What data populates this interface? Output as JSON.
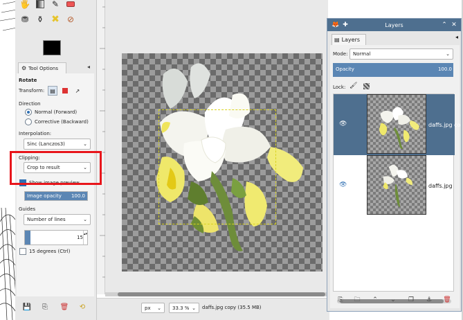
{
  "tool_options": {
    "tab_label": "Tool Options",
    "title": "Rotate",
    "transform_label": "Transform:",
    "direction_label": "Direction",
    "direction_options": [
      "Normal (Forward)",
      "Corrective (Backward)"
    ],
    "interpolation_label": "Interpolation:",
    "interpolation_value": "Sinc (Lanczos3)",
    "clipping_label": "Clipping:",
    "clipping_value": "Crop to result",
    "show_preview_label": "Show image preview",
    "image_opacity_label": "Image opacity",
    "image_opacity_value": "100.0",
    "guides_label": "Guides",
    "guides_value": "Number of lines",
    "guides_count": "15",
    "constraint_label": "15 degrees  (Ctrl)"
  },
  "status_bar": {
    "unit": "px",
    "zoom": "33.3 %",
    "image_info": "daffs.jpg copy (35.5 MB)"
  },
  "layers": {
    "window_title": "Layers",
    "tab_label": "Layers",
    "mode_label": "Mode:",
    "mode_value": "Normal",
    "opacity_label": "Opacity",
    "opacity_value": "100.0",
    "lock_label": "Lock:",
    "items": [
      {
        "name": "daffs.jpg co",
        "selected": true
      },
      {
        "name": "daffs.jpg",
        "selected": false
      }
    ]
  },
  "colors": {
    "accent": "#4e6f8f",
    "highlight_box": "#e8151b",
    "selection_outline": "#d9d31e"
  },
  "icons": [
    "smudge-icon",
    "gradient-icon",
    "paintbrush-icon",
    "eraser-icon",
    "clone-icon",
    "heal-icon",
    "smudge-x-icon",
    "dodge-icon",
    "close-icon",
    "pin-icon"
  ]
}
